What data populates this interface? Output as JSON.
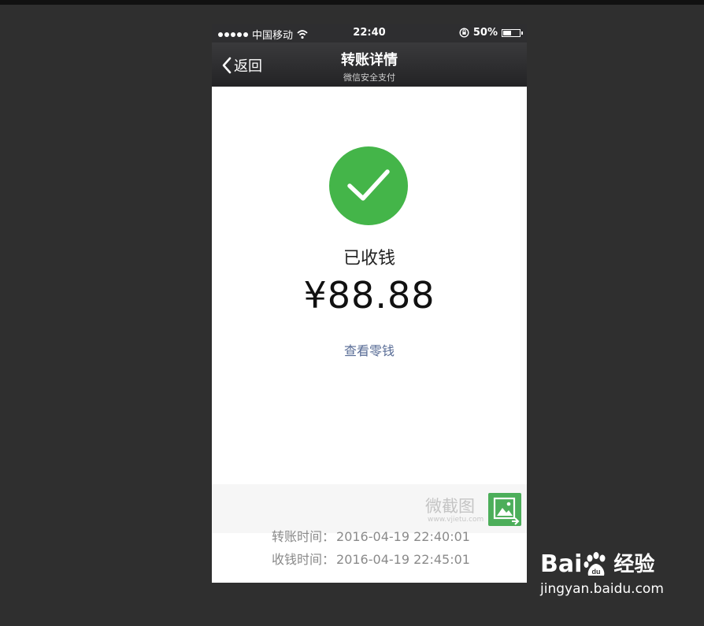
{
  "status_bar": {
    "carrier": "中国移动",
    "time": "22:40",
    "battery": "50%",
    "battery_level": 0.5,
    "icons": [
      "signal-dots-icon",
      "wifi-icon",
      "orientation-lock-icon",
      "battery-icon"
    ]
  },
  "nav": {
    "back_label": "返回",
    "title": "转账详情",
    "subtitle": "微信安全支付"
  },
  "receipt": {
    "status": "已收钱",
    "amount": "¥88.88",
    "view_change_link": "查看零钱",
    "accent_color": "#44b549",
    "link_color": "#576b95"
  },
  "details": [
    {
      "label": "转账时间：",
      "value": "2016-04-19 22:40:01"
    },
    {
      "label": "收钱时间：",
      "value": "2016-04-19 22:45:01"
    }
  ],
  "watermark": {
    "text": "微截图",
    "url": "www.vjietu.com"
  },
  "baidu": {
    "brand_left": "Bai",
    "brand_right": "经验",
    "url": "jingyan.baidu.com"
  }
}
